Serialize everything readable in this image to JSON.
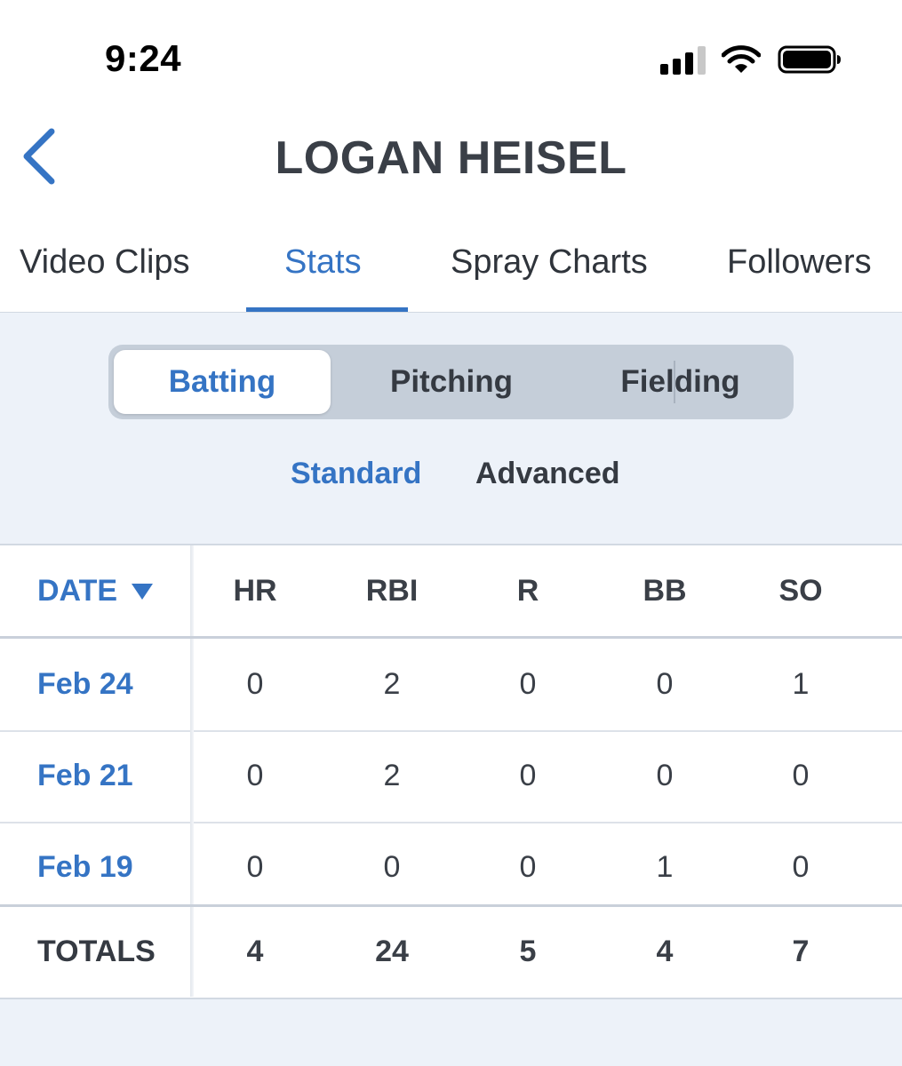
{
  "status_bar": {
    "time": "9:24"
  },
  "header": {
    "title": "LOGAN HEISEL"
  },
  "tabs": [
    {
      "label": "Video Clips",
      "active": false
    },
    {
      "label": "Stats",
      "active": true
    },
    {
      "label": "Spray Charts",
      "active": false
    },
    {
      "label": "Followers",
      "active": false
    }
  ],
  "segmented": [
    {
      "label": "Batting",
      "selected": true
    },
    {
      "label": "Pitching",
      "selected": false
    },
    {
      "label": "Fielding",
      "selected": false
    }
  ],
  "subtabs": [
    {
      "label": "Standard",
      "active": true
    },
    {
      "label": "Advanced",
      "active": false
    }
  ],
  "table": {
    "columns": [
      "DATE",
      "HR",
      "RBI",
      "R",
      "BB",
      "SO"
    ],
    "rows": [
      {
        "date": "Feb 24",
        "values": [
          "0",
          "2",
          "0",
          "0",
          "1"
        ]
      },
      {
        "date": "Feb 21",
        "values": [
          "0",
          "2",
          "0",
          "0",
          "0"
        ]
      },
      {
        "date": "Feb 19",
        "values": [
          "0",
          "0",
          "0",
          "1",
          "0"
        ]
      }
    ],
    "totals": {
      "label": "TOTALS",
      "values": [
        "4",
        "24",
        "5",
        "4",
        "7"
      ]
    }
  },
  "colors": {
    "accent": "#3574c4",
    "text": "#353a42",
    "background": "#edf2f9"
  },
  "icons": [
    "back-chevron-icon",
    "signal-icon",
    "wifi-icon",
    "battery-icon",
    "sort-down-icon"
  ]
}
